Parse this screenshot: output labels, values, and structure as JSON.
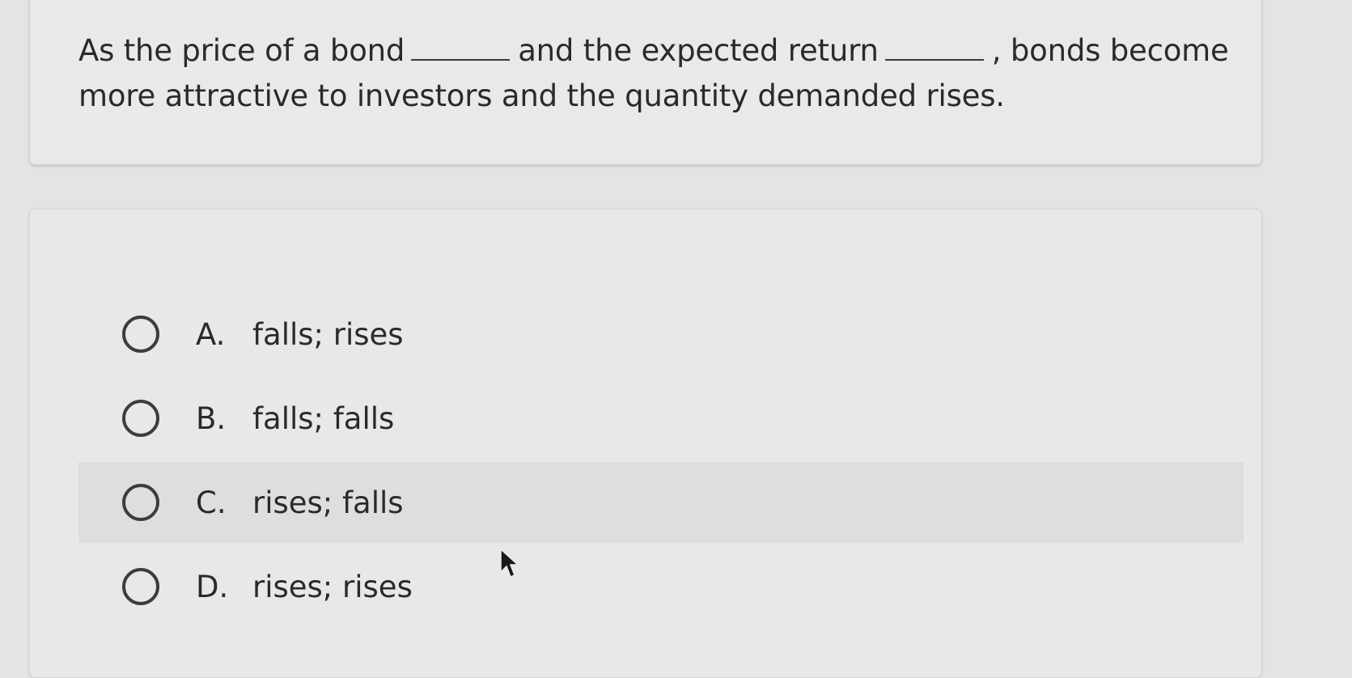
{
  "question": {
    "part1": "As the price of a bond",
    "part2": "and the expected return",
    "part3": ", bonds become more attractive to investors and the quantity demanded rises."
  },
  "options": [
    {
      "letter": "A.",
      "text": "falls; rises"
    },
    {
      "letter": "B.",
      "text": "falls; falls"
    },
    {
      "letter": "C.",
      "text": "rises; falls"
    },
    {
      "letter": "D.",
      "text": "rises; rises"
    }
  ],
  "icons": {
    "radio": "radio-button-icon",
    "cursor": "mouse-pointer-icon"
  }
}
